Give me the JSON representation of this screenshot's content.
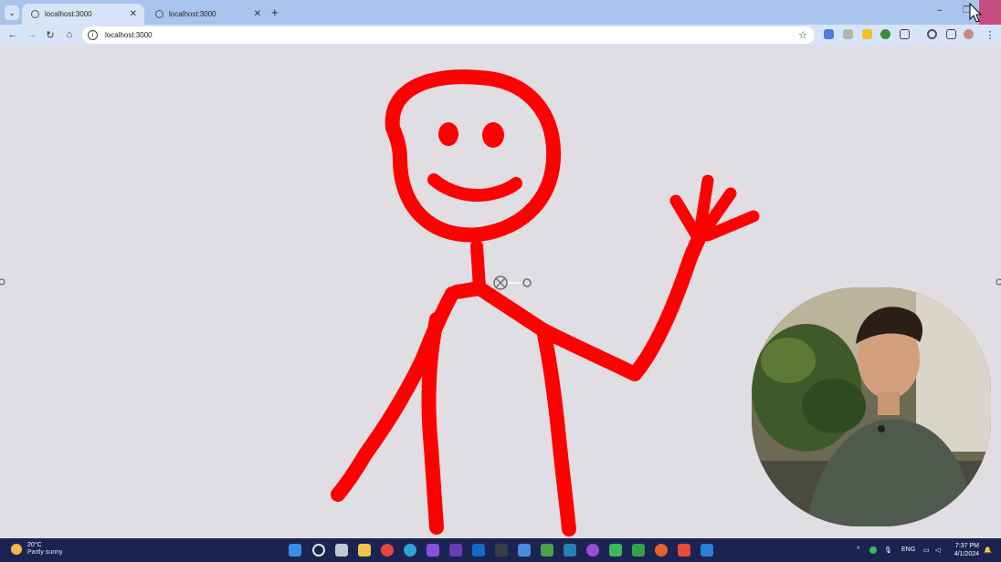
{
  "browser": {
    "tabs": [
      {
        "title": "localhost:3000",
        "active": true
      },
      {
        "title": "localhost:3000",
        "active": false
      }
    ],
    "new_tab_label": "+",
    "address": "localhost:3000",
    "accent": "#a8c4ec"
  },
  "canvas": {
    "stroke_color": "#ff0000",
    "background": "#e1dee3",
    "drawing": "stick-figure-waving"
  },
  "taskbar": {
    "weather_temp": "20°C",
    "weather_desc": "Partly sunny",
    "language": "ENG",
    "time": "7:37 PM",
    "date": "4/1/2024"
  }
}
